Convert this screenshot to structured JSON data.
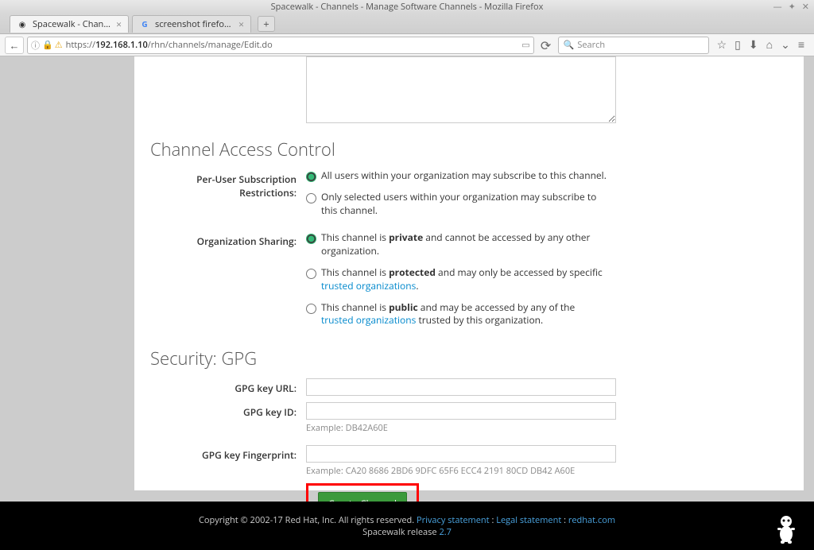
{
  "window": {
    "title": "Spacewalk - Channels - Manage Software Channels - Mozilla Firefox"
  },
  "tabs": [
    {
      "label": "Spacewalk - Channels - Ma..."
    },
    {
      "label": "screenshot firefox linux - G..."
    }
  ],
  "url": {
    "scheme": "https://",
    "host": "192.168.1.10",
    "path": "/rhn/channels/manage/Edit.do"
  },
  "search": {
    "placeholder": "Search"
  },
  "sections": {
    "access": "Channel Access Control",
    "security": "Security: GPG"
  },
  "labels": {
    "perUser": "Per-User Subscription Restrictions:",
    "orgSharing": "Organization Sharing:",
    "gpgUrl": "GPG key URL:",
    "gpgId": "GPG key ID:",
    "gpgFp": "GPG key Fingerprint:"
  },
  "radios": {
    "perUser": {
      "all": "All users within your organization may subscribe to this channel.",
      "selected": "Only selected users within your organization may subscribe to this channel."
    },
    "org": {
      "private_pre": "This channel is ",
      "private_b": "private",
      "private_post": " and cannot be accessed by any other organization.",
      "protected_pre": "This channel is ",
      "protected_b": "protected",
      "protected_post1": " and may only be accessed by specific ",
      "protected_link": "trusted organizations",
      "protected_post2": ".",
      "public_pre": "This channel is ",
      "public_b": "public",
      "public_post1": " and may be accessed by any of the ",
      "public_link": "trusted organizations",
      "public_post2": " trusted by this organization."
    }
  },
  "hints": {
    "gpgId": "Example: DB42A60E",
    "gpgFp": "Example: CA20 8686 2BD6 9DFC 65F6 ECC4 2191 80CD DB42 A60E"
  },
  "buttons": {
    "create": "Create Channel"
  },
  "footer": {
    "copyright": "Copyright © 2002-17 Red Hat, Inc. All rights reserved. ",
    "privacy": "Privacy statement",
    "sep": " : ",
    "legal": "Legal statement",
    "redhat": "redhat.com",
    "release_pre": "Spacewalk release ",
    "release_ver": "2.7"
  }
}
